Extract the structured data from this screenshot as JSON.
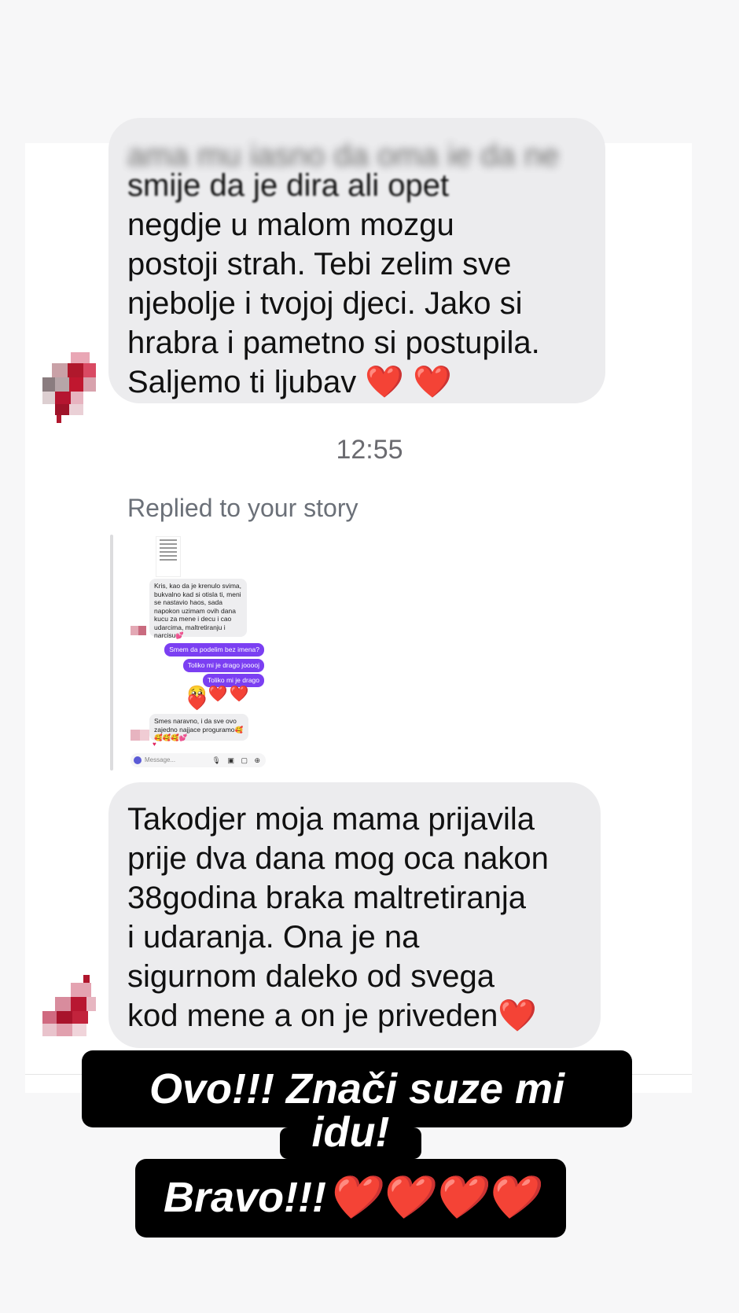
{
  "messages": [
    {
      "blurred_first_line": "ama mu jasno da oma je da ne",
      "lines": [
        "smije da je dira ali opet",
        "negdje u malom mozgu",
        "postoji strah. Tebi zelim sve",
        "njebolje i tvojoj djeci. Jako si",
        "hrabra i pametno si postupila.",
        "Saljemo ti ljubav ❤️ ❤️"
      ]
    },
    {
      "lines": [
        "Takodjer moja mama prijavila",
        "prije dva dana mog oca nakon",
        "38godina braka maltretiranja",
        "i udaranja. Ona je na",
        "sigurnom daleko od svega",
        "kod mene a on je priveden❤️"
      ]
    }
  ],
  "timestamp": "12:55",
  "replied_label": "Replied to your story",
  "story_preview": {
    "incoming_text": "Kris, kao da je krenulo svima, bukvalno kad si otisla ti, meni se nastavio haos, sada napokon uzimam ovih dana kucu za mene i decu i cao udarcima, maltretiranju i narcisu💕",
    "outgoing": [
      "Smem da podelim bez imena?",
      "Toliko mi je drago jooooj",
      "Toliko mi je drago"
    ],
    "emoji_row": "🥺❤️❤️❤️",
    "incoming_text_2": "Smes naravno, i da sve ovo zajedno najjace proguramo🥰🥰🥰🥰💕",
    "heart": "♥",
    "input_placeholder": "Message...",
    "input_tools": "🎙 ▣ ▢ ⊕"
  },
  "overlay": {
    "line1": "Ovo!!! Znači suze mi",
    "line2": "idu!",
    "line3": "Bravo!!!❤️❤️❤️❤️"
  },
  "colors": {
    "bubble": "#ececee",
    "overlay_bg": "#000000",
    "purple": "#7b3ff2"
  }
}
